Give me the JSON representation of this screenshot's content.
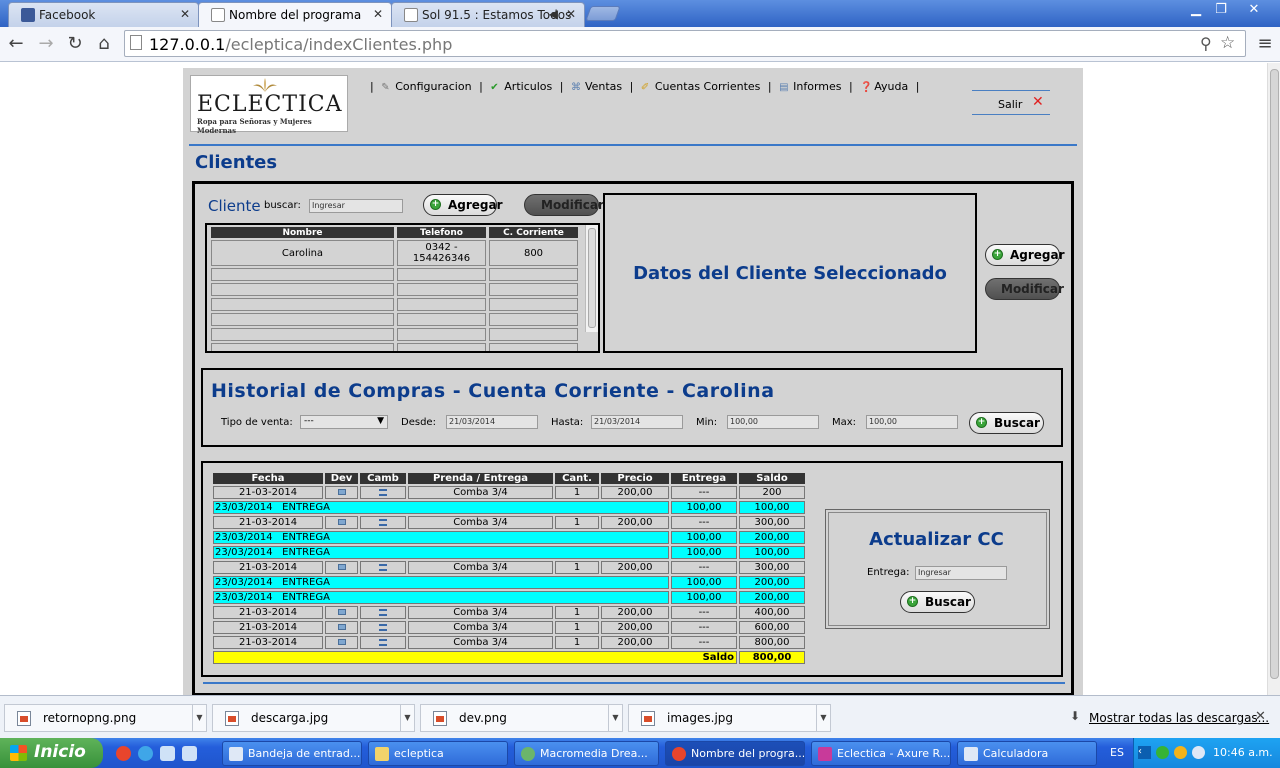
{
  "browser": {
    "tabs": [
      {
        "label": "Facebook",
        "color": "#3b5998"
      },
      {
        "label": "Nombre del programa",
        "color": "#ffffff"
      },
      {
        "label": "Sol 91.5 : Estamos Todos",
        "color": "#ffffff"
      }
    ],
    "url_host": "127.0.0.1",
    "url_path": "/ecleptica/indexClientes.php"
  },
  "logo": {
    "brand": "ECLECTICA",
    "tagline": "Ropa para Señoras y Mujeres Modernas"
  },
  "menu": [
    {
      "label": "Configuracion",
      "icon": "wrench-icon"
    },
    {
      "label": "Articulos",
      "icon": "check-icon"
    },
    {
      "label": "Ventas",
      "icon": "cart-icon"
    },
    {
      "label": "Cuentas Corrientes",
      "icon": "pencil-icon"
    },
    {
      "label": "Informes",
      "icon": "document-icon"
    },
    {
      "label": "Ayuda",
      "icon": "help-icon"
    }
  ],
  "salir": "Salir",
  "page_title": "Clientes",
  "cliente": {
    "title": "Cliente",
    "buscar_label": "buscar:",
    "buscar_placeholder": "Ingresar",
    "agregar": "Agregar",
    "modificar": "Modificar",
    "columns": [
      "Nombre",
      "Telefono",
      "C. Corriente"
    ],
    "rows": [
      [
        "Carolina",
        "0342 - 154426346",
        "800"
      ]
    ]
  },
  "datos": {
    "title": "Datos del Cliente Seleccionado",
    "agregar": "Agregar",
    "modificar": "Modificar"
  },
  "historial": {
    "title": "Historial de Compras - Cuenta Corriente - Carolina",
    "tipo_label": "Tipo de venta:",
    "tipo_value": "---",
    "desde_label": "Desde:",
    "desde_value": "21/03/2014",
    "hasta_label": "Hasta:",
    "hasta_value": "21/03/2014",
    "min_label": "Min:",
    "min_value": "100,00",
    "max_label": "Max:",
    "max_value": "100,00",
    "buscar": "Buscar"
  },
  "compras": {
    "columns": [
      "Fecha",
      "Dev",
      "Camb",
      "Prenda / Entrega",
      "Cant.",
      "Precio",
      "Entrega",
      "Saldo"
    ],
    "rows": [
      {
        "type": "venta",
        "fecha": "21-03-2014",
        "prenda": "Comba 3/4",
        "cant": "1",
        "precio": "200,00",
        "entrega": "---",
        "saldo": "200"
      },
      {
        "type": "entrega",
        "label": "23/03/2014   ENTREGA",
        "entrega": "100,00",
        "saldo": "100,00"
      },
      {
        "type": "venta",
        "fecha": "21-03-2014",
        "prenda": "Comba 3/4",
        "cant": "1",
        "precio": "200,00",
        "entrega": "---",
        "saldo": "300,00"
      },
      {
        "type": "entrega",
        "label": "23/03/2014   ENTREGA",
        "entrega": "100,00",
        "saldo": "200,00"
      },
      {
        "type": "entrega",
        "label": "23/03/2014   ENTREGA",
        "entrega": "100,00",
        "saldo": "100,00"
      },
      {
        "type": "venta",
        "fecha": "21-03-2014",
        "prenda": "Comba 3/4",
        "cant": "1",
        "precio": "200,00",
        "entrega": "---",
        "saldo": "300,00"
      },
      {
        "type": "entrega",
        "label": "23/03/2014   ENTREGA",
        "entrega": "100,00",
        "saldo": "200,00"
      },
      {
        "type": "entrega",
        "label": "23/03/2014   ENTREGA",
        "entrega": "100,00",
        "saldo": "200,00"
      },
      {
        "type": "venta",
        "fecha": "21-03-2014",
        "prenda": "Comba 3/4",
        "cant": "1",
        "precio": "200,00",
        "entrega": "---",
        "saldo": "400,00"
      },
      {
        "type": "venta",
        "fecha": "21-03-2014",
        "prenda": "Comba 3/4",
        "cant": "1",
        "precio": "200,00",
        "entrega": "---",
        "saldo": "600,00"
      },
      {
        "type": "venta",
        "fecha": "21-03-2014",
        "prenda": "Comba 3/4",
        "cant": "1",
        "precio": "200,00",
        "entrega": "---",
        "saldo": "800,00"
      }
    ],
    "total_label": "Saldo",
    "total_value": "800,00"
  },
  "actualizar": {
    "title": "Actualizar CC",
    "entrega_label": "Entrega:",
    "entrega_placeholder": "Ingresar",
    "buscar": "Buscar"
  },
  "downloads": {
    "items": [
      "retornopng.png",
      "descarga.jpg",
      "dev.png",
      "images.jpg"
    ],
    "show_all": "Mostrar todas las descargas..."
  },
  "taskbar": {
    "start": "Inicio",
    "tasks": [
      "Bandeja de entrad...",
      "ecleptica",
      "Macromedia Drea...",
      "Nombre del progra...",
      "Eclectica - Axure R...",
      "Calculadora"
    ],
    "lang": "ES",
    "clock": "10:46 a.m."
  }
}
